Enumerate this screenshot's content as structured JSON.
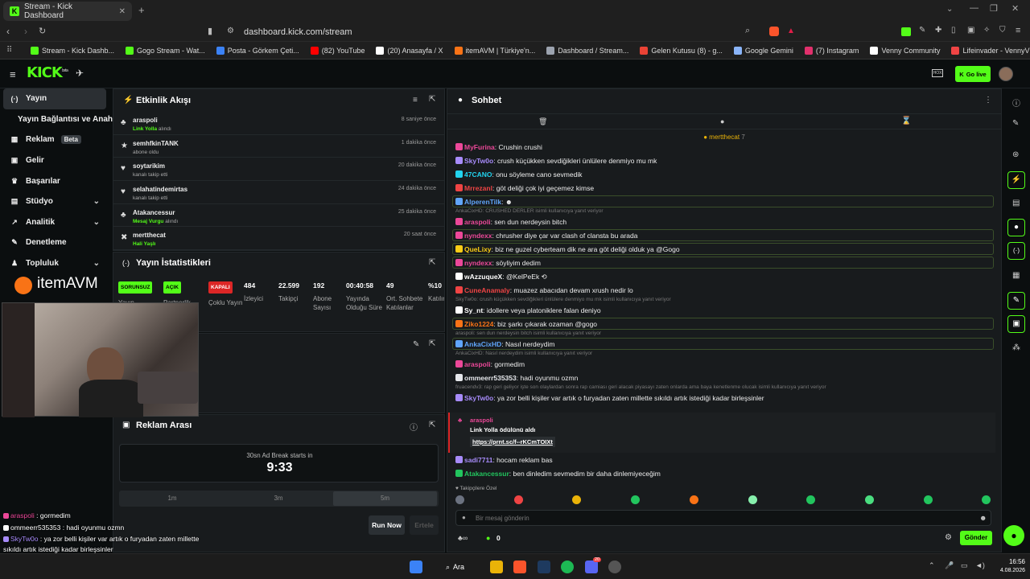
{
  "browser": {
    "tab_title": "Stream - Kick Dashboard",
    "url": "dashboard.kick.com/stream",
    "bookmarks": [
      {
        "label": "Stream - Kick Dashb...",
        "color": "#53fc18"
      },
      {
        "label": "Gogo Stream - Wat...",
        "color": "#53fc18"
      },
      {
        "label": "Posta - Görkem Çeti...",
        "color": "#3b82f6"
      },
      {
        "label": "(82) YouTube",
        "color": "#ff0000"
      },
      {
        "label": "(20) Anasayfa / X",
        "color": "#ffffff"
      },
      {
        "label": "itemAVM | Türkiye'n...",
        "color": "#f97316"
      },
      {
        "label": "Dashboard / Stream...",
        "color": "#9ca3af"
      },
      {
        "label": "Gelen Kutusu (8) - g...",
        "color": "#ea4335"
      },
      {
        "label": "Google Gemini",
        "color": "#8ab4f8"
      },
      {
        "label": "(7) Instagram",
        "color": "#e1306c"
      },
      {
        "label": "Venny Community",
        "color": "#ffffff"
      },
      {
        "label": "Lifeinvader - VennyV",
        "color": "#ef4444"
      }
    ]
  },
  "header": {
    "logo": "KICK",
    "logo_sup": "beta",
    "golive_label": "Go live",
    "mode_label": "HOX"
  },
  "sidebar": {
    "items": [
      {
        "label": "Yayın",
        "icon": "broadcast-icon",
        "glyph": "(·)",
        "active": true
      },
      {
        "label": "Yayın Bağlantısı ve Anahtarı",
        "icon": "",
        "glyph": ""
      },
      {
        "label": "Reklam",
        "icon": "ad-icon",
        "glyph": "▦",
        "badge": "Beta"
      },
      {
        "label": "Gelir",
        "icon": "revenue-icon",
        "glyph": "▣"
      },
      {
        "label": "Başarılar",
        "icon": "trophy-icon",
        "glyph": "♛"
      },
      {
        "label": "Stüdyo",
        "icon": "studio-icon",
        "glyph": "▤",
        "chevron": true
      },
      {
        "label": "Analitik",
        "icon": "analytics-icon",
        "glyph": "↗",
        "chevron": true
      },
      {
        "label": "Denetleme",
        "icon": "moderation-icon",
        "glyph": "✎"
      },
      {
        "label": "Topluluk",
        "icon": "community-icon",
        "glyph": "♟",
        "chevron": true
      }
    ]
  },
  "activity": {
    "title": "Etkinlik Akışı",
    "events": [
      {
        "name": "araspoli",
        "sub_prefix": "Link Yolla",
        "sub": " alındı",
        "time": "8 saniye önce",
        "icon": "♣"
      },
      {
        "name": "semhfkinTANK",
        "sub_prefix": "",
        "sub": "abone oldu",
        "time": "1 dakika önce",
        "icon": "★"
      },
      {
        "name": "soytarikim",
        "sub_prefix": "",
        "sub": "kanalı takip etti",
        "time": "20 dakika önce",
        "icon": "♥"
      },
      {
        "name": "selahatindemirtas",
        "sub_prefix": "",
        "sub": "kanalı takip etti",
        "time": "24 dakika önce",
        "icon": "♥"
      },
      {
        "name": "Atakancessur",
        "sub_prefix": "Mesaj Vurgu",
        "sub": " alındı",
        "time": "25 dakika önce",
        "icon": "♣"
      },
      {
        "name": "mertthecat",
        "sub_prefix": "Hali Yaşlı",
        "sub": "",
        "time": "20 saat önce",
        "icon": "✖"
      }
    ]
  },
  "stats": {
    "title": "Yayın İstatistikleri",
    "items": [
      {
        "pill": "SORUNSUZ",
        "pill_color": "#53fc18",
        "label": "Yayın"
      },
      {
        "pill": "AÇIK",
        "pill_color": "#53fc18",
        "label": "Partnerlik"
      },
      {
        "pill": "KAPALI",
        "pill_color": "#dc2626",
        "label": "Çoklu Yayın"
      },
      {
        "value": "484",
        "label": "İzleyici"
      },
      {
        "value": "22.599",
        "label": "Takipçi"
      },
      {
        "value": "192",
        "label": "Abone Sayısı"
      },
      {
        "value": "00:40:58",
        "label": "Yayında Olduğu Süre"
      },
      {
        "value": "49",
        "label": "Ort. Sohbete Katılanlar"
      },
      {
        "value": "%10",
        "label": "Katılım"
      }
    ]
  },
  "ad_break": {
    "title": "Reklam Arası",
    "caption": "30sn Ad Break starts in",
    "countdown": "9:33",
    "durations": [
      "1m",
      "3m",
      "5m"
    ],
    "run_label": "Run Now",
    "delay_label": "Ertele"
  },
  "overlay_logo": "itemAVM",
  "chat": {
    "title": "Sohbet",
    "pinned_user": "mertthecat",
    "pinned_count": "7",
    "lines": [
      {
        "type": "msg",
        "user": "MyFurina",
        "color": "#ec4899",
        "text": ": Crushin crushi"
      },
      {
        "type": "msg",
        "user": "SkyTw0o",
        "color": "#a78bfa",
        "text": ": crush küçükken sevdiğikleri ünlülere denmiyo mu mk"
      },
      {
        "type": "msg",
        "user": "47CANO",
        "color": "#22d3ee",
        "text": ": onu söyleme cano sevmedik"
      },
      {
        "type": "msg",
        "user": "Mrrezanl",
        "color": "#ef4444",
        "text": ": göt deliği çok iyi geçemez kimse"
      },
      {
        "type": "msg",
        "user": "AlperenTilk",
        "color": "#60a5fa",
        "text": ": ☻",
        "boxed": true
      },
      {
        "type": "reply",
        "text": "AnkaCixHD: CRUSHED DERLER isimli kullanıcıya yanıt veriyor"
      },
      {
        "type": "msg",
        "user": "araspoli",
        "color": "#ec4899",
        "text": ": sen dun nerdeysin bitch"
      },
      {
        "type": "msg",
        "user": "nyndexx",
        "color": "#ec4899",
        "text": ": chrusher diye çar var clash of clansta bu arada",
        "boxed": true
      },
      {
        "type": "msg",
        "user": "QueLixy",
        "color": "#facc15",
        "text": ": biz ne guzel cyberteam dik ne ara göt deliği olduk ya @Gogo",
        "boxed": true
      },
      {
        "type": "msg",
        "user": "nyndexx",
        "color": "#ec4899",
        "text": ": söyliyim dedim",
        "boxed": true
      },
      {
        "type": "msg",
        "user": "wAzzuqueX",
        "color": "#ffffff",
        "text": ": @KelPeEk ⟲"
      },
      {
        "type": "msg",
        "user": "CuneAnamaly",
        "color": "#ef4444",
        "text": ": muazez abacıdan devam xrush nedir lo"
      },
      {
        "type": "reply",
        "text": "SkyTw0o: crush küçükken sevdiğikleri ünlülere denmiyo mu mk isimli kullanıcıya yanıt veriyor"
      },
      {
        "type": "msg",
        "user": "Sy_nt",
        "color": "#ffffff",
        "text": ": idollere veya platoniklere falan deniyo"
      },
      {
        "type": "msg",
        "user": "Ziko1224",
        "color": "#f97316",
        "text": ": biz şarkı çıkarak ozaman @gogo",
        "boxed": true
      },
      {
        "type": "reply",
        "text": "araspoli: sen dun nerdeysin bitch isimli kullanıcıya yanıt veriyor"
      },
      {
        "type": "msg",
        "user": "AnkaCixHD",
        "color": "#60a5fa",
        "text": ": Nasıl nerdeydim",
        "boxed": true
      },
      {
        "type": "reply",
        "text": "AnkaCixHD: Nasıl nerdeydim isimli kullanıcıya yanıt veriyor"
      },
      {
        "type": "msg",
        "user": "araspoli",
        "color": "#ec4899",
        "text": ": gormedim"
      },
      {
        "type": "msg",
        "user": "ommeerr535353",
        "color": "#e5e7eb",
        "text": ": hadi oyunmu ozmn"
      },
      {
        "type": "reply",
        "text": "fruacendv3: rap geri geliyor işte son olaylardan sonra rap camiası geri alacak piyasayı zaten onlarda ama baya kenetlenme olucak isimli kullanıcıya yanıt veriyor"
      },
      {
        "type": "msg",
        "user": "SkyTw0o",
        "color": "#a78bfa",
        "text": ": ya zor belli kişiler var artık o furyadan zaten millette sıkıldı artık istediği kadar birleşsinler"
      }
    ],
    "reward": {
      "user": "araspoli",
      "text": "Link Yolla ödülünü aldı",
      "link": "https://prnt.sc/f--rKCmTOIXt"
    },
    "after": [
      {
        "user": "sadi7711",
        "color": "#a78bfa",
        "text": ": hocam reklam bas"
      },
      {
        "user": "Atakancessur",
        "color": "#22c55e",
        "text": ": ben dinledim sevmedim bir daha dinlemiyeceğim"
      }
    ],
    "emote_header": "♥ Takipçilere Özel",
    "input_placeholder": "Bir mesaj gönderin",
    "send_label": "Gönder",
    "points": "0"
  },
  "overlay_chat": [
    {
      "user": "araspoli",
      "color": "#ec4899",
      "text": " : gormedim"
    },
    {
      "user": "ommeerr535353",
      "color": "#ffffff",
      "text": " : hadi oyunmu ozmn"
    },
    {
      "user": "SkyTw0o",
      "color": "#a78bfa",
      "text": " : ya zor belli kişiler var artık o furyadan zaten millette"
    },
    {
      "user": "",
      "color": "#ffffff",
      "text": "sıkıldı artık istediği kadar birleşsinler"
    },
    {
      "user": "sadi7711",
      "color": "#ffffff",
      "text": " : hocam reklam bas"
    },
    {
      "user": "Atakancessur",
      "color": "#22c55e",
      "text": " : ben dinledim sevmedim bir daha dinlemiyeceğim"
    }
  ],
  "taskbar": {
    "search_label": "Ara",
    "time": "16:56",
    "date": "4.08.2026",
    "badge": "20"
  },
  "colors": {
    "accent": "#53fc18",
    "panel": "#181b1d",
    "bg": "#0b0e0f"
  }
}
